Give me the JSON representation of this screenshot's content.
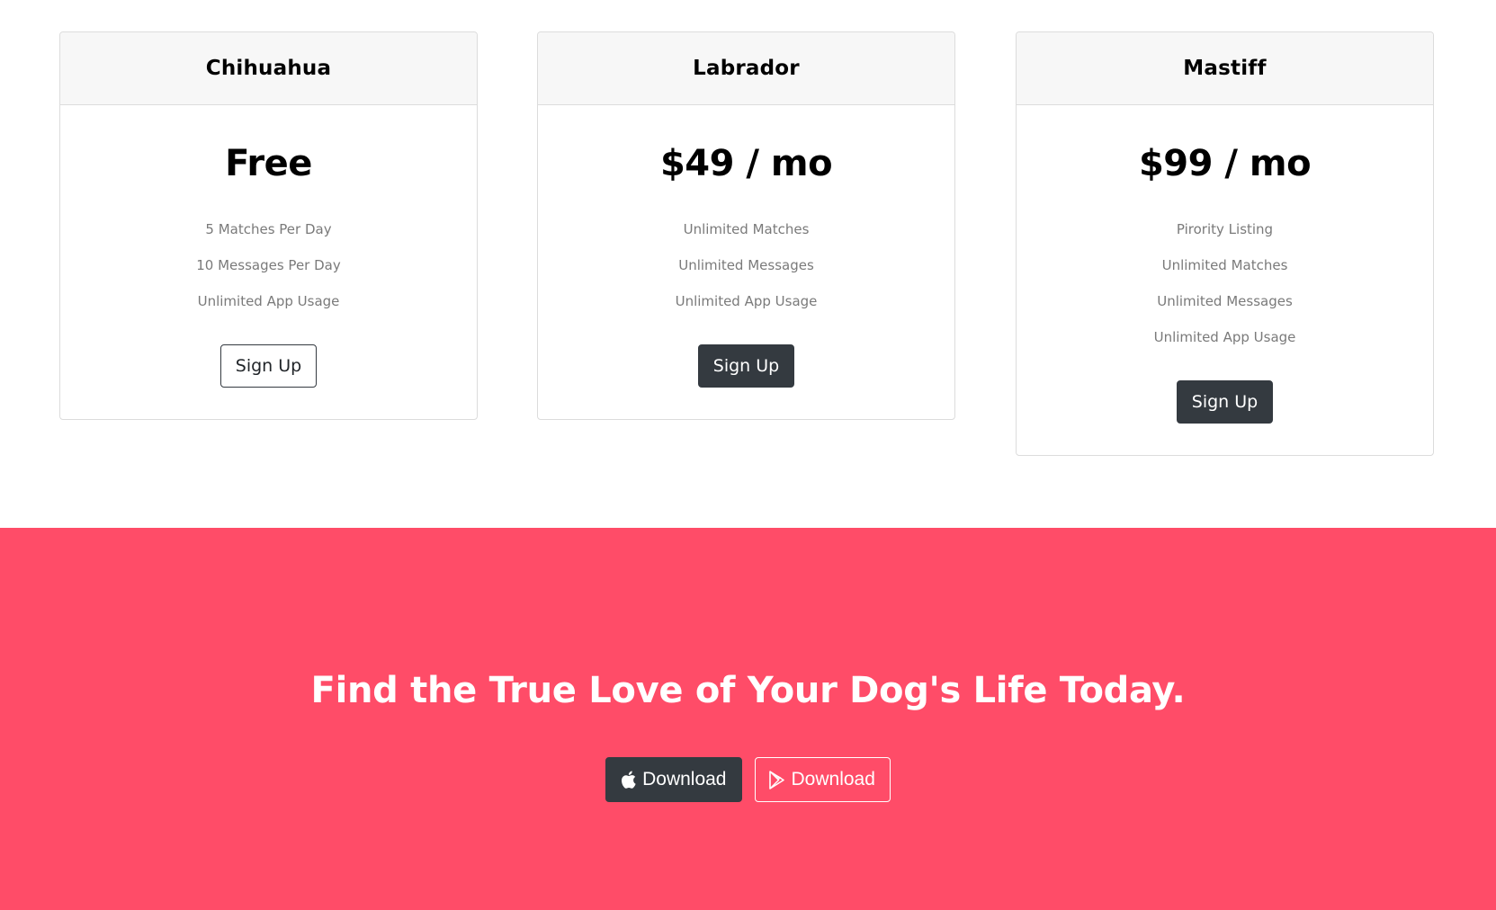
{
  "pricing": {
    "plans": [
      {
        "name": "Chihuahua",
        "price": "Free",
        "features": [
          "5 Matches Per Day",
          "10 Messages Per Day",
          "Unlimited App Usage"
        ],
        "button_label": "Sign Up"
      },
      {
        "name": "Labrador",
        "price": "$49 / mo",
        "features": [
          "Unlimited Matches",
          "Unlimited Messages",
          "Unlimited App Usage"
        ],
        "button_label": "Sign Up"
      },
      {
        "name": "Mastiff",
        "price": "$99 / mo",
        "features": [
          "Pirority Listing",
          "Unlimited Matches",
          "Unlimited Messages",
          "Unlimited App Usage"
        ],
        "button_label": "Sign Up"
      }
    ]
  },
  "cta": {
    "title": "Find the True Love of Your Dog's Life Today.",
    "background_color": "#ff4c68",
    "apple_button": {
      "label": "Download",
      "icon": "apple-icon"
    },
    "play_button": {
      "label": "Download",
      "icon": "google-play-icon"
    }
  },
  "colors": {
    "dark_button": "#343a40",
    "accent": "#ff4c68"
  }
}
